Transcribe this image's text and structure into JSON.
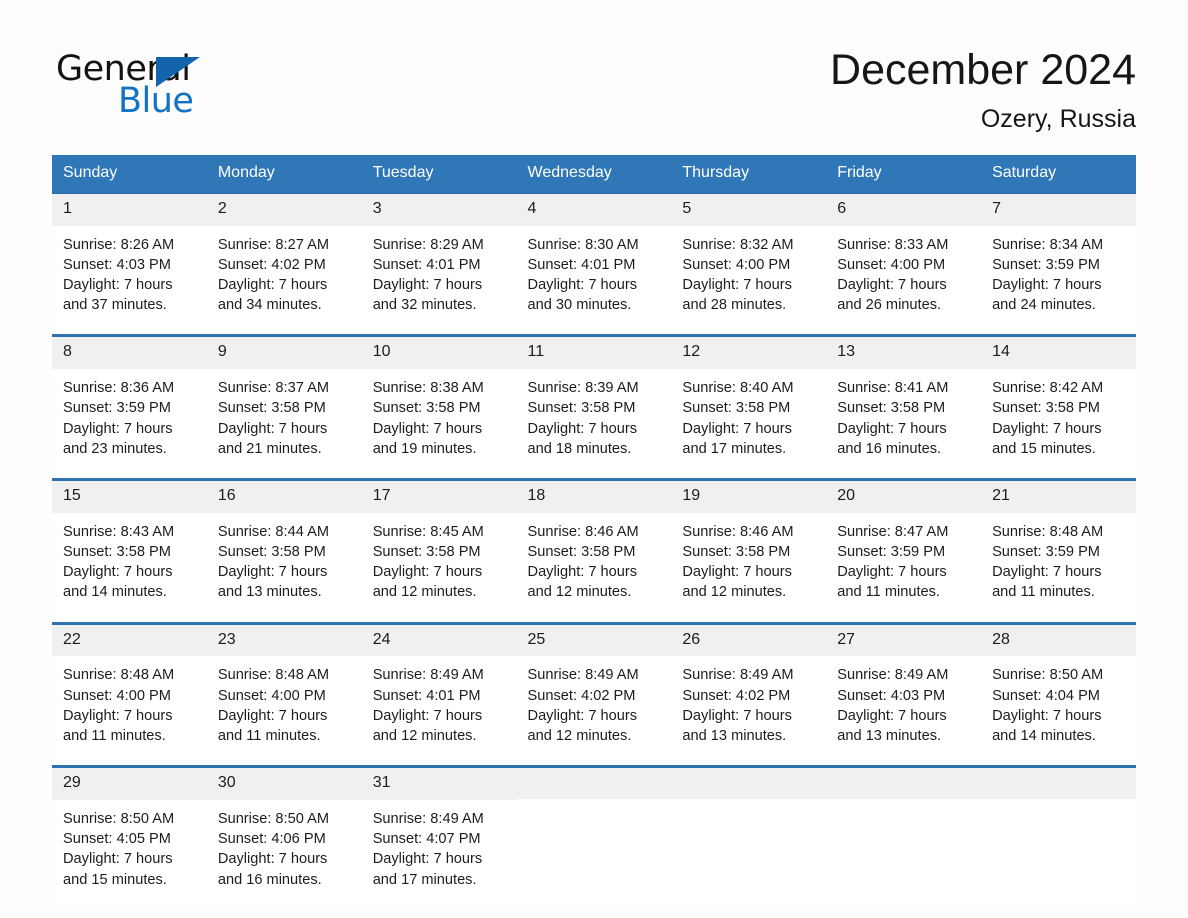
{
  "logo": {
    "word_general": "General",
    "word_blue": "Blue",
    "triangle_color": "#1464ac",
    "blue_color": "#1173c4"
  },
  "header": {
    "month_title": "December 2024",
    "location": "Ozery, Russia"
  },
  "theme": {
    "header_blue": "#3077b8",
    "row_border_blue": "#2d71b0",
    "daynum_band": "#f0f0f0",
    "page_background": "#fdfdfd"
  },
  "calendar": {
    "weekday_headers": [
      "Sunday",
      "Monday",
      "Tuesday",
      "Wednesday",
      "Thursday",
      "Friday",
      "Saturday"
    ],
    "weeks": [
      [
        {
          "day": "1",
          "sunrise": "Sunrise: 8:26 AM",
          "sunset": "Sunset: 4:03 PM",
          "daylight_line1": "Daylight: 7 hours",
          "daylight_line2": "and 37 minutes."
        },
        {
          "day": "2",
          "sunrise": "Sunrise: 8:27 AM",
          "sunset": "Sunset: 4:02 PM",
          "daylight_line1": "Daylight: 7 hours",
          "daylight_line2": "and 34 minutes."
        },
        {
          "day": "3",
          "sunrise": "Sunrise: 8:29 AM",
          "sunset": "Sunset: 4:01 PM",
          "daylight_line1": "Daylight: 7 hours",
          "daylight_line2": "and 32 minutes."
        },
        {
          "day": "4",
          "sunrise": "Sunrise: 8:30 AM",
          "sunset": "Sunset: 4:01 PM",
          "daylight_line1": "Daylight: 7 hours",
          "daylight_line2": "and 30 minutes."
        },
        {
          "day": "5",
          "sunrise": "Sunrise: 8:32 AM",
          "sunset": "Sunset: 4:00 PM",
          "daylight_line1": "Daylight: 7 hours",
          "daylight_line2": "and 28 minutes."
        },
        {
          "day": "6",
          "sunrise": "Sunrise: 8:33 AM",
          "sunset": "Sunset: 4:00 PM",
          "daylight_line1": "Daylight: 7 hours",
          "daylight_line2": "and 26 minutes."
        },
        {
          "day": "7",
          "sunrise": "Sunrise: 8:34 AM",
          "sunset": "Sunset: 3:59 PM",
          "daylight_line1": "Daylight: 7 hours",
          "daylight_line2": "and 24 minutes."
        }
      ],
      [
        {
          "day": "8",
          "sunrise": "Sunrise: 8:36 AM",
          "sunset": "Sunset: 3:59 PM",
          "daylight_line1": "Daylight: 7 hours",
          "daylight_line2": "and 23 minutes."
        },
        {
          "day": "9",
          "sunrise": "Sunrise: 8:37 AM",
          "sunset": "Sunset: 3:58 PM",
          "daylight_line1": "Daylight: 7 hours",
          "daylight_line2": "and 21 minutes."
        },
        {
          "day": "10",
          "sunrise": "Sunrise: 8:38 AM",
          "sunset": "Sunset: 3:58 PM",
          "daylight_line1": "Daylight: 7 hours",
          "daylight_line2": "and 19 minutes."
        },
        {
          "day": "11",
          "sunrise": "Sunrise: 8:39 AM",
          "sunset": "Sunset: 3:58 PM",
          "daylight_line1": "Daylight: 7 hours",
          "daylight_line2": "and 18 minutes."
        },
        {
          "day": "12",
          "sunrise": "Sunrise: 8:40 AM",
          "sunset": "Sunset: 3:58 PM",
          "daylight_line1": "Daylight: 7 hours",
          "daylight_line2": "and 17 minutes."
        },
        {
          "day": "13",
          "sunrise": "Sunrise: 8:41 AM",
          "sunset": "Sunset: 3:58 PM",
          "daylight_line1": "Daylight: 7 hours",
          "daylight_line2": "and 16 minutes."
        },
        {
          "day": "14",
          "sunrise": "Sunrise: 8:42 AM",
          "sunset": "Sunset: 3:58 PM",
          "daylight_line1": "Daylight: 7 hours",
          "daylight_line2": "and 15 minutes."
        }
      ],
      [
        {
          "day": "15",
          "sunrise": "Sunrise: 8:43 AM",
          "sunset": "Sunset: 3:58 PM",
          "daylight_line1": "Daylight: 7 hours",
          "daylight_line2": "and 14 minutes."
        },
        {
          "day": "16",
          "sunrise": "Sunrise: 8:44 AM",
          "sunset": "Sunset: 3:58 PM",
          "daylight_line1": "Daylight: 7 hours",
          "daylight_line2": "and 13 minutes."
        },
        {
          "day": "17",
          "sunrise": "Sunrise: 8:45 AM",
          "sunset": "Sunset: 3:58 PM",
          "daylight_line1": "Daylight: 7 hours",
          "daylight_line2": "and 12 minutes."
        },
        {
          "day": "18",
          "sunrise": "Sunrise: 8:46 AM",
          "sunset": "Sunset: 3:58 PM",
          "daylight_line1": "Daylight: 7 hours",
          "daylight_line2": "and 12 minutes."
        },
        {
          "day": "19",
          "sunrise": "Sunrise: 8:46 AM",
          "sunset": "Sunset: 3:58 PM",
          "daylight_line1": "Daylight: 7 hours",
          "daylight_line2": "and 12 minutes."
        },
        {
          "day": "20",
          "sunrise": "Sunrise: 8:47 AM",
          "sunset": "Sunset: 3:59 PM",
          "daylight_line1": "Daylight: 7 hours",
          "daylight_line2": "and 11 minutes."
        },
        {
          "day": "21",
          "sunrise": "Sunrise: 8:48 AM",
          "sunset": "Sunset: 3:59 PM",
          "daylight_line1": "Daylight: 7 hours",
          "daylight_line2": "and 11 minutes."
        }
      ],
      [
        {
          "day": "22",
          "sunrise": "Sunrise: 8:48 AM",
          "sunset": "Sunset: 4:00 PM",
          "daylight_line1": "Daylight: 7 hours",
          "daylight_line2": "and 11 minutes."
        },
        {
          "day": "23",
          "sunrise": "Sunrise: 8:48 AM",
          "sunset": "Sunset: 4:00 PM",
          "daylight_line1": "Daylight: 7 hours",
          "daylight_line2": "and 11 minutes."
        },
        {
          "day": "24",
          "sunrise": "Sunrise: 8:49 AM",
          "sunset": "Sunset: 4:01 PM",
          "daylight_line1": "Daylight: 7 hours",
          "daylight_line2": "and 12 minutes."
        },
        {
          "day": "25",
          "sunrise": "Sunrise: 8:49 AM",
          "sunset": "Sunset: 4:02 PM",
          "daylight_line1": "Daylight: 7 hours",
          "daylight_line2": "and 12 minutes."
        },
        {
          "day": "26",
          "sunrise": "Sunrise: 8:49 AM",
          "sunset": "Sunset: 4:02 PM",
          "daylight_line1": "Daylight: 7 hours",
          "daylight_line2": "and 13 minutes."
        },
        {
          "day": "27",
          "sunrise": "Sunrise: 8:49 AM",
          "sunset": "Sunset: 4:03 PM",
          "daylight_line1": "Daylight: 7 hours",
          "daylight_line2": "and 13 minutes."
        },
        {
          "day": "28",
          "sunrise": "Sunrise: 8:50 AM",
          "sunset": "Sunset: 4:04 PM",
          "daylight_line1": "Daylight: 7 hours",
          "daylight_line2": "and 14 minutes."
        }
      ],
      [
        {
          "day": "29",
          "sunrise": "Sunrise: 8:50 AM",
          "sunset": "Sunset: 4:05 PM",
          "daylight_line1": "Daylight: 7 hours",
          "daylight_line2": "and 15 minutes."
        },
        {
          "day": "30",
          "sunrise": "Sunrise: 8:50 AM",
          "sunset": "Sunset: 4:06 PM",
          "daylight_line1": "Daylight: 7 hours",
          "daylight_line2": "and 16 minutes."
        },
        {
          "day": "31",
          "sunrise": "Sunrise: 8:49 AM",
          "sunset": "Sunset: 4:07 PM",
          "daylight_line1": "Daylight: 7 hours",
          "daylight_line2": "and 17 minutes."
        },
        {
          "day": "",
          "sunrise": "",
          "sunset": "",
          "daylight_line1": "",
          "daylight_line2": ""
        },
        {
          "day": "",
          "sunrise": "",
          "sunset": "",
          "daylight_line1": "",
          "daylight_line2": ""
        },
        {
          "day": "",
          "sunrise": "",
          "sunset": "",
          "daylight_line1": "",
          "daylight_line2": ""
        },
        {
          "day": "",
          "sunrise": "",
          "sunset": "",
          "daylight_line1": "",
          "daylight_line2": ""
        }
      ]
    ]
  }
}
